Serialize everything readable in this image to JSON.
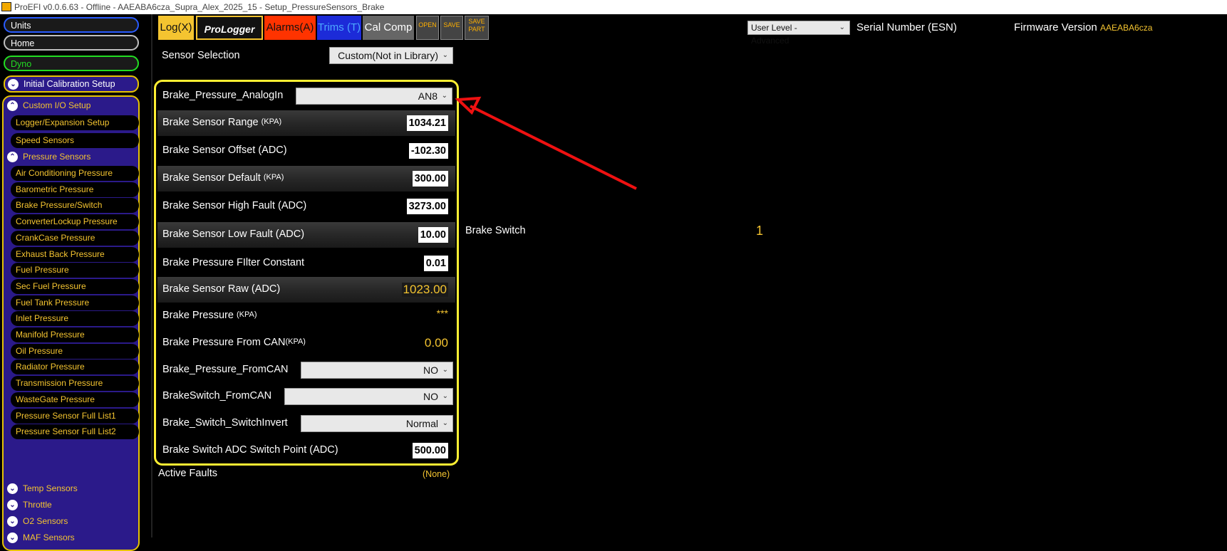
{
  "title": "ProEFI v0.0.6.63 - Offline - AAEABA6cza_Supra_Alex_2025_15 - Setup_PressureSensors_Brake",
  "sidebar": {
    "units": "Units",
    "home": "Home",
    "dyno": "Dyno",
    "initial": "Initial Calibration Setup",
    "custom_io": "Custom I/O Setup",
    "logger": "Logger/Expansion Setup",
    "speed": "Speed Sensors",
    "pressure": "Pressure Sensors",
    "items": [
      "Air Conditioning Pressure",
      "Barometric Pressure",
      "Brake Pressure/Switch",
      "ConverterLockup Pressure",
      "CrankCase Pressure",
      "Exhaust Back Pressure",
      "Fuel Pressure",
      "Sec Fuel Pressure",
      "Fuel Tank Pressure",
      "Inlet Pressure",
      "Manifold Pressure",
      "Oil Pressure",
      "Radiator Pressure",
      "Transmission Pressure",
      "WasteGate Pressure",
      "Pressure Sensor Full List1",
      "Pressure Sensor Full List2"
    ],
    "temp": "Temp Sensors",
    "throttle": "Throttle",
    "o2": "O2 Sensors",
    "maf": "MAF Sensors"
  },
  "toolbar": {
    "log": "Log(X)",
    "prologger": "ProLogger",
    "alarms": "Alarms(A)",
    "trims": "Trims (T)",
    "calcomp": "Cal Comp",
    "open": "OPEN",
    "save": "SAVE",
    "savepart": "SAVE PART"
  },
  "header": {
    "user_level": "User Level - Advanced",
    "serial_label": "Serial Number (ESN)",
    "firmware_label": "Firmware Version",
    "firmware_value": "AAEABA6cza"
  },
  "sensor_selection": {
    "label": "Sensor Selection",
    "value": "Custom(Not in Library)"
  },
  "panel": {
    "analog_label": "Brake_Pressure_AnalogIn",
    "analog_value": "AN8",
    "range_label": "Brake Sensor Range",
    "range_unit": "(KPA)",
    "range_value": "1034.21",
    "offset_label": "Brake Sensor Offset (ADC)",
    "offset_value": "-102.30",
    "default_label": "Brake Sensor Default",
    "default_unit": "(KPA)",
    "default_value": "300.00",
    "highfault_label": "Brake Sensor High Fault (ADC)",
    "highfault_value": "3273.00",
    "lowfault_label": "Brake Sensor Low Fault (ADC)",
    "lowfault_value": "10.00",
    "filter_label": "Brake Pressure FIlter Constant",
    "filter_value": "0.01",
    "raw_label": "Brake Sensor Raw (ADC)",
    "raw_value": "1023.00",
    "pressure_label": "Brake Pressure",
    "pressure_unit": "(KPA)",
    "pressure_value": "***",
    "fromcan_label": "Brake Pressure From CAN",
    "fromcan_unit": "(KPA)",
    "fromcan_value": "0.00",
    "pfromcan_label": "Brake_Pressure_FromCAN",
    "pfromcan_value": "NO",
    "sfromcan_label": "BrakeSwitch_FromCAN",
    "sfromcan_value": "NO",
    "invert_label": "Brake_Switch_SwitchInvert",
    "invert_value": "Normal",
    "switchpoint_label": "Brake Switch ADC Switch Point (ADC)",
    "switchpoint_value": "500.00"
  },
  "faults": {
    "label": "Active Faults",
    "value": "(None)"
  },
  "brake_switch": {
    "label": "Brake Switch",
    "value": "1"
  }
}
